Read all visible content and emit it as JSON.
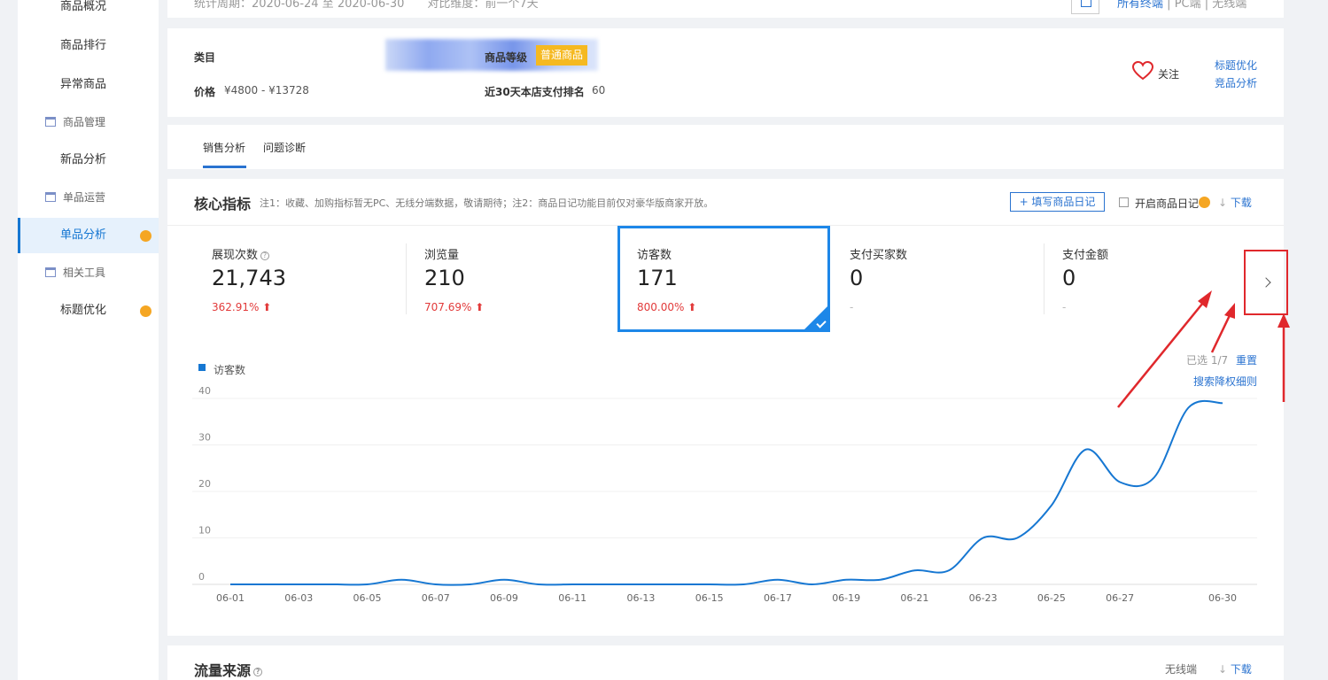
{
  "sidebar": {
    "items": [
      {
        "label": "商品概况",
        "type": "item"
      },
      {
        "label": "商品排行",
        "type": "item"
      },
      {
        "label": "异常商品",
        "type": "item"
      },
      {
        "label": "商品管理",
        "type": "group"
      },
      {
        "label": "新品分析",
        "type": "item"
      },
      {
        "label": "单品运营",
        "type": "group"
      },
      {
        "label": "单品分析",
        "type": "item",
        "active": true,
        "dot": true
      },
      {
        "label": "相关工具",
        "type": "group"
      },
      {
        "label": "标题优化",
        "type": "item",
        "dot": true
      }
    ]
  },
  "topbar": {
    "period": "统计周期：2020-06-24 至 2020-06-30　　对比维度：前一个7天",
    "term_all": "所有终端",
    "term_pc": "PC端",
    "term_wireless": "无线端",
    "sep": "|"
  },
  "product": {
    "category_label": "类目",
    "price_label": "价格",
    "price_value": "¥4800 - ¥13728",
    "grade_label": "商品等级",
    "grade_value": "普通商品",
    "rank_label": "近30天本店支付排名",
    "rank_value": "60",
    "follow": "关注",
    "link_title": "标题优化",
    "link_compete": "竞品分析"
  },
  "tabs": [
    {
      "label": "销售分析",
      "active": true
    },
    {
      "label": "问题诊断",
      "active": false
    }
  ],
  "core": {
    "title": "核心指标",
    "note": "注1：收藏、加购指标暂无PC、无线分端数据，敬请期待；注2：商品日记功能目前仅对豪华版商家开放。",
    "diary_button": "+ 填写商品日记",
    "diary_toggle": "开启商品日记",
    "download": "下载",
    "download_icon": "↓",
    "metrics": [
      {
        "label": "展现次数",
        "value": "21,743",
        "change": "362.91%",
        "trend": "up",
        "help": true
      },
      {
        "label": "浏览量",
        "value": "210",
        "change": "707.69%",
        "trend": "up"
      },
      {
        "label": "访客数",
        "value": "171",
        "change": "800.00%",
        "trend": "up",
        "selected": true
      },
      {
        "label": "支付买家数",
        "value": "0",
        "change": "-"
      },
      {
        "label": "支付金额",
        "value": "0",
        "change": "-"
      }
    ],
    "trend_up_glyph": "⬆",
    "help_glyph": "?",
    "picked": "已选 1/7",
    "reset": "重置",
    "rule_link": "搜索降权细则"
  },
  "chart_data": {
    "type": "line",
    "legend": [
      "访客数"
    ],
    "series": [
      {
        "name": "访客数",
        "color": "#1677d2",
        "x": [
          "06-01",
          "06-02",
          "06-03",
          "06-04",
          "06-05",
          "06-06",
          "06-07",
          "06-08",
          "06-09",
          "06-10",
          "06-11",
          "06-12",
          "06-13",
          "06-14",
          "06-15",
          "06-16",
          "06-17",
          "06-18",
          "06-19",
          "06-20",
          "06-21",
          "06-22",
          "06-23",
          "06-24",
          "06-25",
          "06-26",
          "06-27",
          "06-28",
          "06-29",
          "06-30"
        ],
        "values": [
          0,
          0,
          0,
          0,
          0,
          1,
          0,
          0,
          1,
          0,
          0,
          0,
          0,
          0,
          0,
          0,
          1,
          0,
          1,
          1,
          3,
          3,
          10,
          10,
          17,
          29,
          22,
          23,
          38,
          39
        ]
      }
    ],
    "x_tick_labels": [
      "06-01",
      "06-03",
      "06-05",
      "06-07",
      "06-09",
      "06-11",
      "06-13",
      "06-15",
      "06-17",
      "06-19",
      "06-21",
      "06-23",
      "06-25",
      "06-27",
      "06-30"
    ],
    "y_ticks": [
      0,
      10,
      20,
      30,
      40
    ],
    "ylim": [
      0,
      40
    ],
    "grid": true,
    "legend_position": "top-left"
  },
  "flow": {
    "title": "流量来源",
    "terminal": "无线端",
    "download": "下载",
    "download_icon": "↓"
  },
  "colors": {
    "accent": "#1677d2",
    "up": "#e23a3a",
    "badge": "#f5b921",
    "annotation": "#e0282c"
  }
}
